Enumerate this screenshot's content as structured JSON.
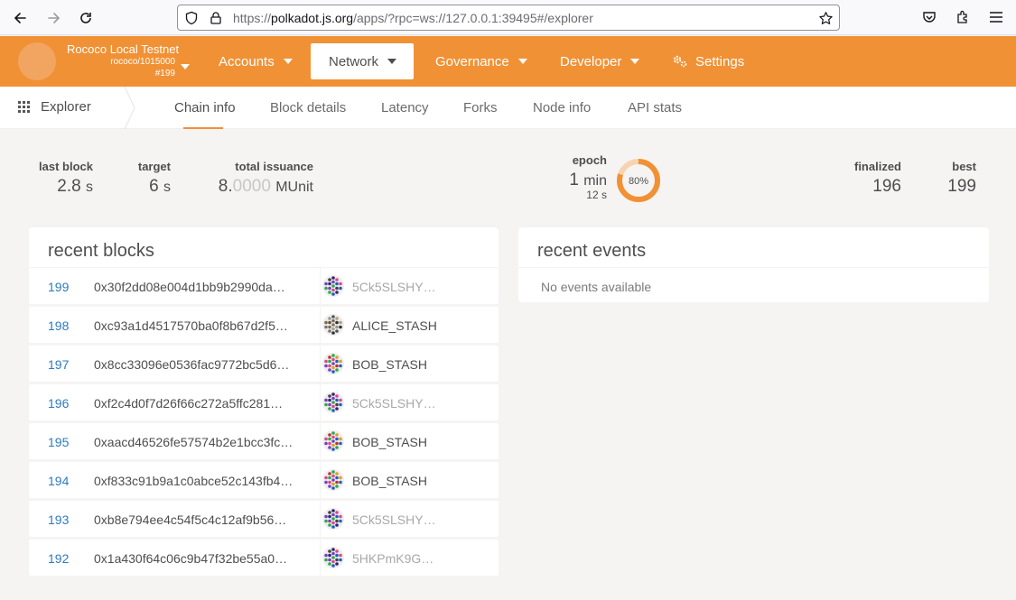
{
  "browser": {
    "url_prefix": "https://",
    "url_host": "polkadot.js.org",
    "url_path": "/apps/?rpc=ws://127.0.0.1:39495#/explorer"
  },
  "header": {
    "chain_name": "Rococo Local Testnet",
    "chain_spec": "rococo/1015000",
    "chain_block": "#199",
    "menu": [
      {
        "label": "Accounts"
      },
      {
        "label": "Network"
      },
      {
        "label": "Governance"
      },
      {
        "label": "Developer"
      },
      {
        "label": "Settings"
      }
    ],
    "accent_color": "#f19135"
  },
  "subnav": {
    "title": "Explorer",
    "tabs": [
      {
        "label": "Chain info"
      },
      {
        "label": "Block details"
      },
      {
        "label": "Latency"
      },
      {
        "label": "Forks"
      },
      {
        "label": "Node info"
      },
      {
        "label": "API stats"
      }
    ]
  },
  "summary": {
    "last_block": {
      "label": "last block",
      "value": "2.8",
      "unit": "s"
    },
    "target": {
      "label": "target",
      "value": "6",
      "unit": "s"
    },
    "total_issuance": {
      "label": "total issuance",
      "value_int": "8.",
      "value_dec": "0000",
      "unit": "MUnit"
    },
    "epoch": {
      "label": "epoch",
      "value": "1",
      "unit": "min",
      "sub_value": "12",
      "sub_unit": "s",
      "percent_text": "80%",
      "progress": 0.8
    },
    "finalized": {
      "label": "finalized",
      "value": "196"
    },
    "best": {
      "label": "best",
      "value": "199"
    }
  },
  "recent_blocks": {
    "title": "recent blocks",
    "rows": [
      {
        "number": "199",
        "hash": "0x30f2dd08e004d1bb9b2990da…",
        "author": "5Ck5SLSHY…",
        "is_address": true
      },
      {
        "number": "198",
        "hash": "0xc93a1d4517570ba0f8b67d2f5…",
        "author": "ALICE_STASH",
        "is_address": false
      },
      {
        "number": "197",
        "hash": "0x8cc33096e0536fac9772bc5d6…",
        "author": "BOB_STASH",
        "is_address": false
      },
      {
        "number": "196",
        "hash": "0xf2c4d0f7d26f66c272a5ffc281…",
        "author": "5Ck5SLSHY…",
        "is_address": true
      },
      {
        "number": "195",
        "hash": "0xaacd46526fe57574b2e1bcc3fc…",
        "author": "BOB_STASH",
        "is_address": false
      },
      {
        "number": "194",
        "hash": "0xf833c91b9a1c0abce52c143fb4…",
        "author": "BOB_STASH",
        "is_address": false
      },
      {
        "number": "193",
        "hash": "0xb8e794ee4c54f5c4c12af9b56…",
        "author": "5Ck5SLSHY…",
        "is_address": true
      },
      {
        "number": "192",
        "hash": "0x1a430f64c06c9b47f32be55a0…",
        "author": "5HKPmK9G…",
        "is_address": true
      }
    ]
  },
  "recent_events": {
    "title": "recent events",
    "empty_text": "No events available"
  }
}
